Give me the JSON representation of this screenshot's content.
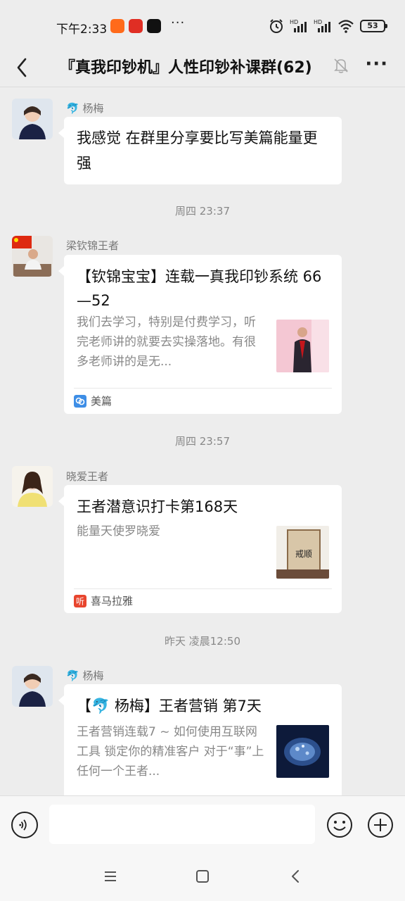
{
  "status_bar": {
    "time": "下午2:33",
    "dots": "···",
    "signal1": "HD",
    "signal2": "HD",
    "battery": "53",
    "icons": [
      "alarm-icon",
      "signal-icon",
      "signal-icon",
      "wifi-icon",
      "battery-icon"
    ]
  },
  "header": {
    "title": "『真我印钞机』人性印钞补课群(62)",
    "back_icon": "back-arrow-icon",
    "mute_icon": "mute-bell-icon",
    "more_icon": "more-icon"
  },
  "messages": [
    {
      "sender": "杨梅",
      "sender_prefix_icon": "dolphin-emoji-icon",
      "text": "我感觉 在群里分享要比写美篇能量更强"
    },
    {
      "time_separator": "周四 23:37",
      "sender": "梁钦锦王者",
      "card": {
        "title": "【钦锦宝宝】连载一真我印钞系统 66—52",
        "description": "我们去学习，特别是付费学习，听完老师讲的就要去实操落地。有很多老师讲的是无...",
        "source": "美篇",
        "source_color": "#3e8ee6"
      }
    },
    {
      "time_separator": "周四 23:57",
      "sender": "晓爱王者",
      "card": {
        "title": "王者潜意识打卡第168天",
        "description": "能量天使罗晓爱",
        "source": "喜马拉雅",
        "source_color": "#e8452e",
        "thumb_text": "戒顺"
      }
    },
    {
      "time_separator": "昨天 凌晨12:50",
      "sender": "杨梅",
      "sender_prefix_icon": "dolphin-emoji-icon",
      "card": {
        "title": "【🐬 杨梅】王者营销 第7天",
        "description": "王者营销连载7 ~ 如何使用互联网工具 锁定你的精准客户 对于“事”上 任何一个王者..."
      }
    }
  ],
  "input_bar": {
    "voice_icon": "voice-icon",
    "placeholder": "",
    "emoji_icon": "emoji-icon",
    "plus_icon": "plus-icon"
  },
  "system_nav": {
    "icons": [
      "menu-icon",
      "home-icon",
      "back-icon"
    ]
  },
  "colors": {
    "background": "#ededed",
    "bubble": "#ffffff",
    "meipian": "#3e8ee6",
    "ximalaya": "#e8452e"
  }
}
